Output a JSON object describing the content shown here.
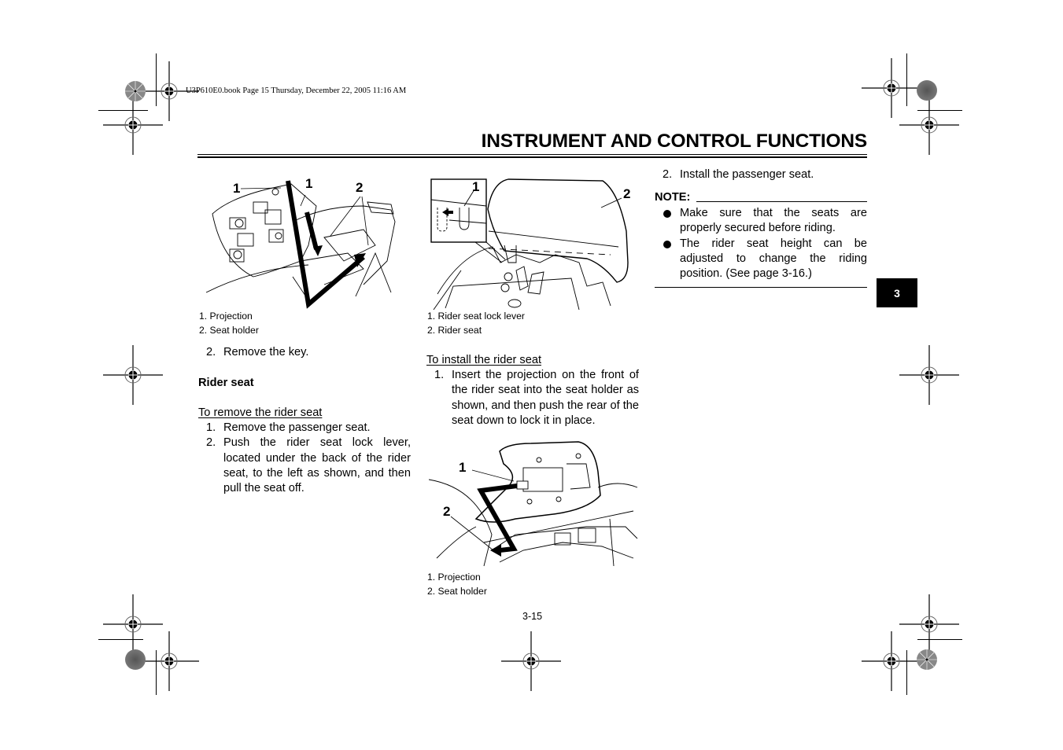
{
  "book_header": "U3P610E0.book  Page 15  Thursday, December 22, 2005  11:16 AM",
  "page_title": "INSTRUMENT AND CONTROL FUNCTIONS",
  "chapter_tab": "3",
  "page_number": "3-15",
  "left_column": {
    "figure": {
      "callouts": [
        "1",
        "1",
        "2"
      ],
      "captions": [
        "1.  Projection",
        "2.  Seat holder"
      ]
    },
    "step_remove_key": {
      "num": "2.",
      "text": "Remove the key."
    },
    "section_heading": "Rider seat",
    "remove_heading": "To remove the rider seat",
    "remove_steps": [
      {
        "num": "1.",
        "text": "Remove the passenger seat."
      },
      {
        "num": "2.",
        "text": "Push the rider seat lock lever, located under the back of the rider seat, to the left as shown, and then pull the seat off."
      }
    ]
  },
  "middle_column": {
    "figure_top": {
      "callouts": [
        "1",
        "2"
      ],
      "captions": [
        "1.  Rider seat lock lever",
        "2.  Rider seat"
      ]
    },
    "install_heading": "To install the rider seat",
    "install_steps": [
      {
        "num": "1.",
        "text": "Insert the projection on the front of the rider seat into the seat holder as shown, and then push the rear of the seat down to lock it in place."
      }
    ],
    "figure_bottom": {
      "callouts": [
        "1",
        "2"
      ],
      "captions": [
        "1.  Projection",
        "2.  Seat holder"
      ]
    }
  },
  "right_column": {
    "step_install_passenger": {
      "num": "2.",
      "text": "Install the passenger seat."
    },
    "note_label": "NOTE:",
    "note_bullets": [
      "Make sure that the seats are properly secured before riding.",
      "The rider seat height can be adjusted to change the riding position. (See page 3-16.)"
    ]
  }
}
